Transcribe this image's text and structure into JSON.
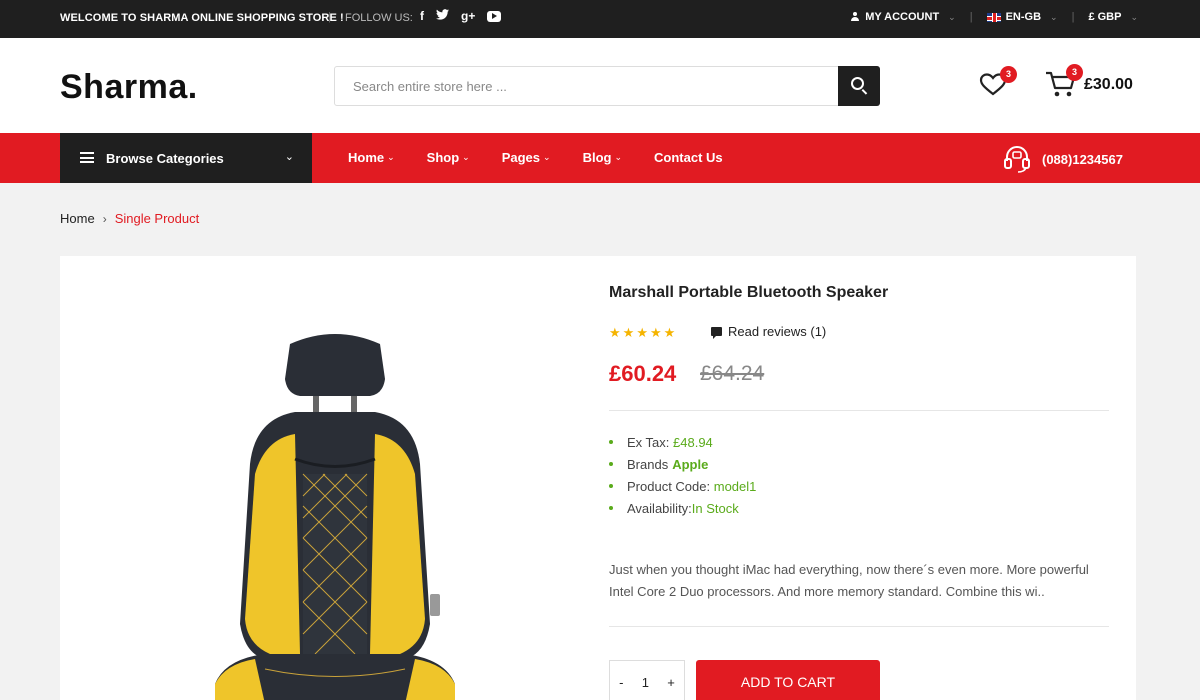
{
  "topbar": {
    "welcome": "WELCOME TO SHARMA ONLINE SHOPPING STORE !",
    "follow": "FOLLOW US:",
    "social": [
      "f",
      "twitter-icon",
      "g+",
      "youtube-icon"
    ],
    "account": "MY ACCOUNT",
    "language": "EN-GB",
    "currency": "£ GBP"
  },
  "header": {
    "logo": "Sharma.",
    "search_placeholder": "Search entire store here ...",
    "wishlist_count": "3",
    "cart_count": "3",
    "cart_total": "£30.00"
  },
  "nav": {
    "browse": "Browse Categories",
    "items": [
      "Home",
      "Shop",
      "Pages",
      "Blog",
      "Contact Us"
    ],
    "phone": "(088)1234567"
  },
  "breadcrumb": {
    "home": "Home",
    "current": "Single Product"
  },
  "product": {
    "title": "Marshall Portable Bluetooth Speaker",
    "rating": 5,
    "reviews": "Read reviews (1)",
    "price_new": "£60.24",
    "price_old": "£64.24",
    "specs": {
      "ex_tax_label": "Ex Tax:",
      "ex_tax_value": "£48.94",
      "brands_label": "Brands",
      "brands_value": "Apple",
      "code_label": "Product Code:",
      "code_value": "model1",
      "availability_label": "Availability:",
      "availability_value": "In Stock"
    },
    "description": "Just when you thought iMac had everything, now there´s even more. More powerful Intel Core 2 Duo processors. And more memory standard. Combine this wi..",
    "quantity": "1",
    "add_to_cart": "ADD TO CART"
  },
  "colors": {
    "accent": "#e11b22",
    "dark": "#1f1f1f",
    "green": "#5aab1b"
  }
}
